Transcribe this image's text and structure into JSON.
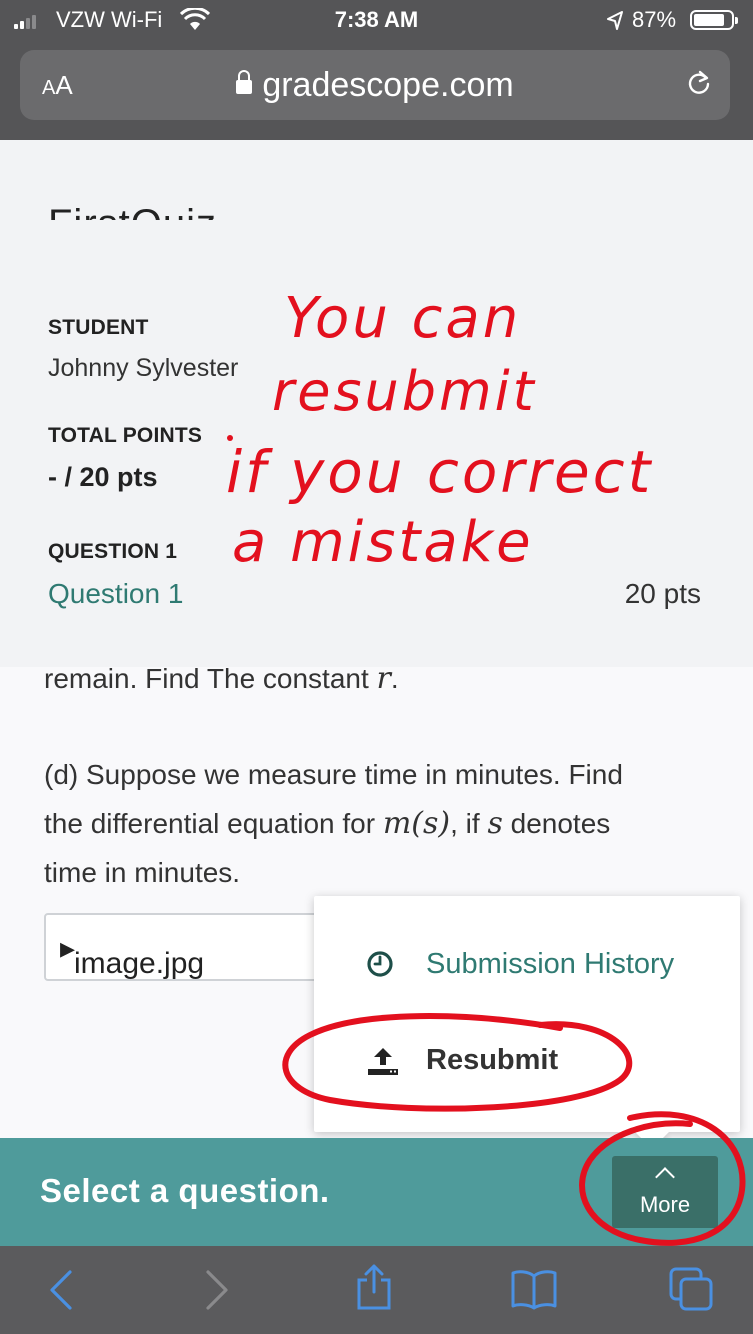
{
  "status_bar": {
    "carrier": "VZW Wi-Fi",
    "time": "7:38 AM",
    "battery": "87%",
    "battery_level": 0.87,
    "signal_bars": 2
  },
  "browser": {
    "text_size_button": "AA",
    "url": "gradescope.com"
  },
  "header": {
    "title_cut": "FirstQuiz",
    "student_label": "STUDENT",
    "student_name": "Johnny Sylvester",
    "total_points_label": "TOTAL POINTS",
    "total_points_value": "- / 20 pts",
    "question_label": "QUESTION 1",
    "question_link": "Question 1",
    "question_points": "20 pts"
  },
  "content": {
    "line_cut_before": "remain. Find The constant ",
    "line_cut_var": "r",
    "line_cut_after": ".",
    "part_d_1": "(d) Suppose we measure time in minutes. Find",
    "part_d_2a": "the differential equation for ",
    "part_d_2_fn": "m(s)",
    "part_d_2b": ", if ",
    "part_d_2_var": "s",
    "part_d_2c": " denotes",
    "part_d_3": "time in minutes.",
    "attachment": "image.jpg"
  },
  "menu": {
    "history_label": "Submission History",
    "resubmit_label": "Resubmit",
    "history_icon": "clock-icon",
    "resubmit_icon": "upload-icon"
  },
  "question_bar": {
    "title": "Select a question.",
    "more_label": "More"
  },
  "annotation": {
    "line1": "You can",
    "line2": "resubmit",
    "line3": "if you correct",
    "line4": "a mistake",
    "color": "#e3101e"
  },
  "colors": {
    "teal_accent": "#2f7a72",
    "bar_teal": "#4f9b9b",
    "more_button": "#3a6f68",
    "ink_red": "#e3101e"
  }
}
